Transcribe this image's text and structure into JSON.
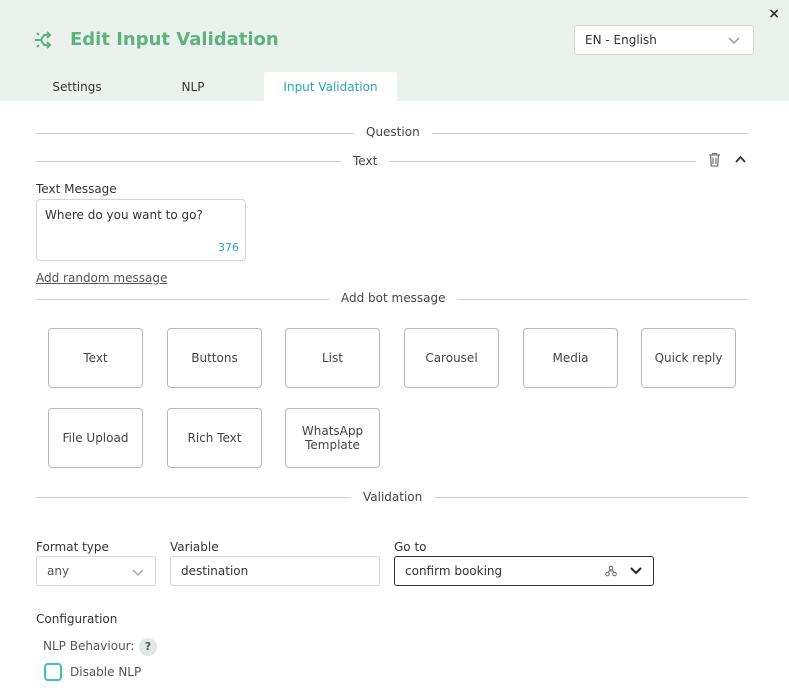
{
  "header": {
    "title": "Edit Input Validation",
    "close_label": "×",
    "language": "EN - English"
  },
  "tabs": [
    {
      "label": "Settings"
    },
    {
      "label": "NLP"
    },
    {
      "label": "Input Validation",
      "active": true
    }
  ],
  "sections": {
    "question": "Question",
    "text": "Text",
    "add_bot_message": "Add bot message",
    "validation": "Validation"
  },
  "text_message": {
    "label": "Text Message",
    "value": "Where do you want to go?",
    "counter": "376",
    "add_random": "Add random message"
  },
  "bot_message_types": [
    "Text",
    "Buttons",
    "List",
    "Carousel",
    "Media",
    "Quick reply",
    "File Upload",
    "Rich Text",
    "WhatsApp Template"
  ],
  "validation": {
    "format_type_label": "Format type",
    "format_type_value": "any",
    "variable_label": "Variable",
    "variable_value": "destination",
    "goto_label": "Go to",
    "goto_value": "confirm booking"
  },
  "configuration": {
    "label": "Configuration",
    "nlp_behaviour_label": "NLP Behaviour:",
    "help": "?",
    "disable_nlp_label": "Disable NLP"
  },
  "colors": {
    "accent_green": "#5cb37d",
    "accent_teal": "#29a6b5",
    "header_bg": "#ebf2ee"
  }
}
